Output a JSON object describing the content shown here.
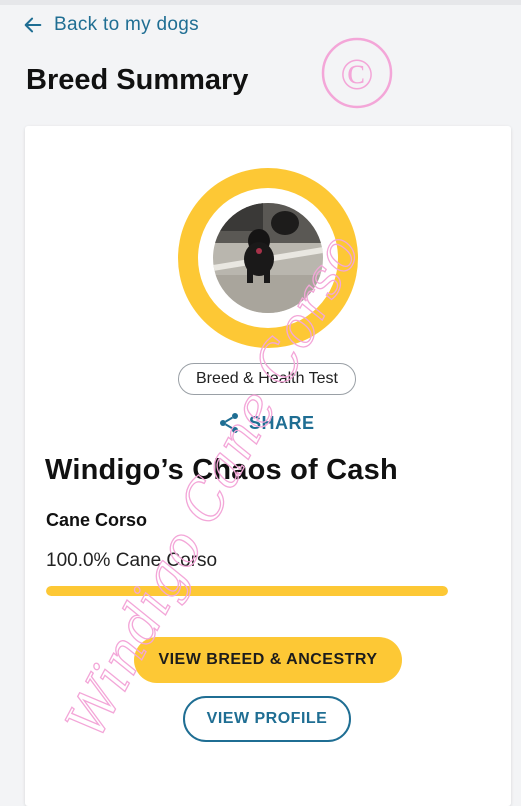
{
  "nav": {
    "back_label": "Back to my dogs"
  },
  "page": {
    "title": "Breed Summary"
  },
  "profile": {
    "badge": "Breed & Health Test",
    "share_label": "SHARE",
    "dog_name": "Windigo’s Chaos of Cash"
  },
  "breed": {
    "name": "Cane Corso",
    "percent_label": "100.0% Cane Corso",
    "percent": 100.0
  },
  "actions": {
    "view_breed_label": "VIEW BREED & ANCESTRY",
    "view_profile_label": "VIEW PROFILE"
  },
  "watermark": {
    "text": "Windigo Cane Corso",
    "symbol": "©"
  },
  "colors": {
    "accent_yellow": "#fdc835",
    "link_blue": "#1f6e93",
    "background": "#f3f4f6",
    "watermark_pink": "#f3a6d8"
  },
  "icons": {
    "back": "arrow-left-icon",
    "share": "share-icon"
  }
}
